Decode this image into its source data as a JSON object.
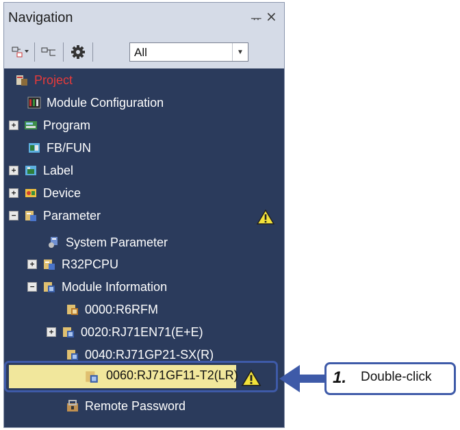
{
  "panel": {
    "title": "Navigation",
    "pin_glyph": "ᅲ",
    "close_glyph": "×"
  },
  "toolbar": {
    "filter_value": "All"
  },
  "tree": [
    {
      "label": "Project",
      "icon": "project-icon"
    },
    {
      "label": "Module Configuration",
      "icon": "module-configuration-icon"
    },
    {
      "label": "Program",
      "icon": "program-icon",
      "expander": "+"
    },
    {
      "label": "FB/FUN",
      "icon": "fb-fun-icon"
    },
    {
      "label": "Label",
      "icon": "label-icon",
      "expander": "+"
    },
    {
      "label": "Device",
      "icon": "device-icon",
      "expander": "+"
    },
    {
      "label": "Parameter",
      "icon": "parameter-icon",
      "expander": "−",
      "warning": true
    },
    {
      "label": "System Parameter",
      "icon": "system-parameter-icon"
    },
    {
      "label": "R32PCPU",
      "icon": "cpu-parameter-icon",
      "expander": "+"
    },
    {
      "label": "Module Information",
      "icon": "module-information-icon",
      "expander": "−"
    },
    {
      "label": "0000:R6RFM",
      "icon": "module-icon"
    },
    {
      "label": "0020:RJ71EN71(E+E)",
      "icon": "module-icon",
      "expander": "+"
    },
    {
      "label": "0040:RJ71GP21-SX(R)",
      "icon": "module-icon"
    },
    {
      "label": "0060:RJ71GF11-T2(LR)",
      "icon": "module-icon",
      "warning": true,
      "selected": true
    },
    {
      "label": "Remote Password",
      "icon": "remote-password-icon"
    }
  ],
  "callout": {
    "step": "1.",
    "text": "Double-click"
  },
  "colors": {
    "panel_bg": "#2b3b5c",
    "header_bg": "#d5dbe7",
    "project_red": "#e83a3a",
    "highlight_yellow": "#f1e79c",
    "frame_blue": "#3e5aa8"
  }
}
